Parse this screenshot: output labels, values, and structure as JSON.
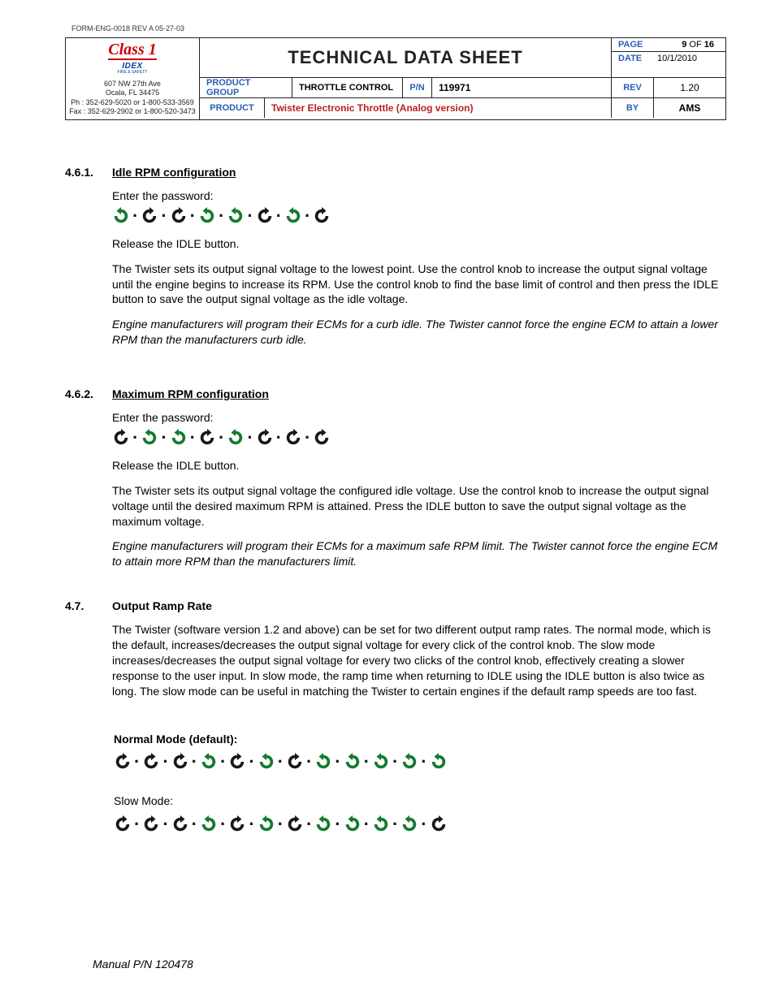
{
  "form_id": "FORM-ENG-0018  REV A  05-27-03",
  "header": {
    "logo_main": "Class 1",
    "logo_sub": "IDEX",
    "logo_sub2": "FIRE & SAFETY",
    "addr1": "607 NW 27th Ave",
    "addr2": "Ocala, FL 34475",
    "phone": "Ph : 352-629-5020 or 1-800-533-3569",
    "fax": "Fax : 352-629-2902 or 1-800-520-3473",
    "title": "TECHNICAL DATA SHEET",
    "page_lbl": "PAGE",
    "page_cur": "9",
    "page_of": "OF",
    "page_tot": "16",
    "date_lbl": "DATE",
    "date_val": "10/1/2010",
    "pg_lbl": "PRODUCT GROUP",
    "pg_val": "THROTTLE CONTROL",
    "pn_lbl": "P/N",
    "pn_val": "119971",
    "rev_lbl": "REV",
    "rev_val": "1.20",
    "prod_lbl": "PRODUCT",
    "prod_val": "Twister Electronic Throttle (Analog version)",
    "by_lbl": "BY",
    "by_val": "AMS"
  },
  "s461": {
    "num": "4.6.1.",
    "title": "Idle RPM configuration",
    "enter": "Enter the password:",
    "seq": [
      "L",
      "R",
      "R",
      "L",
      "L",
      "R",
      "L",
      "R"
    ],
    "p1": "Release the IDLE button.",
    "p2": "The Twister sets its output signal voltage to the lowest point.  Use the control knob to increase the output signal voltage until the engine begins to increase its RPM.  Use the control knob to find the base limit of control and then press the IDLE button to save the output signal voltage as the idle voltage.",
    "p3": "Engine manufacturers will program their ECMs for a curb idle.  The Twister cannot force the engine ECM to attain a lower RPM than the manufacturers curb idle."
  },
  "s462": {
    "num": "4.6.2.",
    "title": "Maximum RPM configuration",
    "enter": "Enter the password:",
    "seq": [
      "R",
      "L",
      "L",
      "R",
      "L",
      "R",
      "R",
      "R"
    ],
    "p1": "Release the IDLE button.",
    "p2": "The Twister sets its output signal voltage the configured idle voltage.  Use the control knob to increase the output signal voltage until the desired maximum RPM is attained.  Press the IDLE button to save the output signal voltage as the maximum voltage.",
    "p3": "Engine manufacturers will program their ECMs for a maximum safe RPM limit.  The Twister cannot force the engine ECM to attain more RPM than the manufacturers limit."
  },
  "s47": {
    "num": "4.7.",
    "title": "Output Ramp Rate",
    "p1": "The Twister (software version 1.2 and above) can be set for two different output ramp rates. The normal mode, which is the default, increases/decreases the output signal voltage for every click of the control knob. The slow mode increases/decreases the output signal voltage for every two clicks of the control knob, effectively creating a slower response to the user input. In slow mode, the ramp time when returning to IDLE using the IDLE button is also twice as long. The slow mode can be useful in matching the Twister to certain engines if the default ramp speeds are too fast.",
    "normal_lbl": "Normal Mode (default):",
    "normal_seq": [
      "R",
      "R",
      "R",
      "L",
      "R",
      "L",
      "R",
      "L",
      "L",
      "L",
      "L",
      "L"
    ],
    "slow_lbl": "Slow Mode:",
    "slow_seq": [
      "R",
      "R",
      "R",
      "L",
      "R",
      "L",
      "R",
      "L",
      "L",
      "L",
      "L",
      "R"
    ]
  },
  "footer": "Manual P/N 120478"
}
